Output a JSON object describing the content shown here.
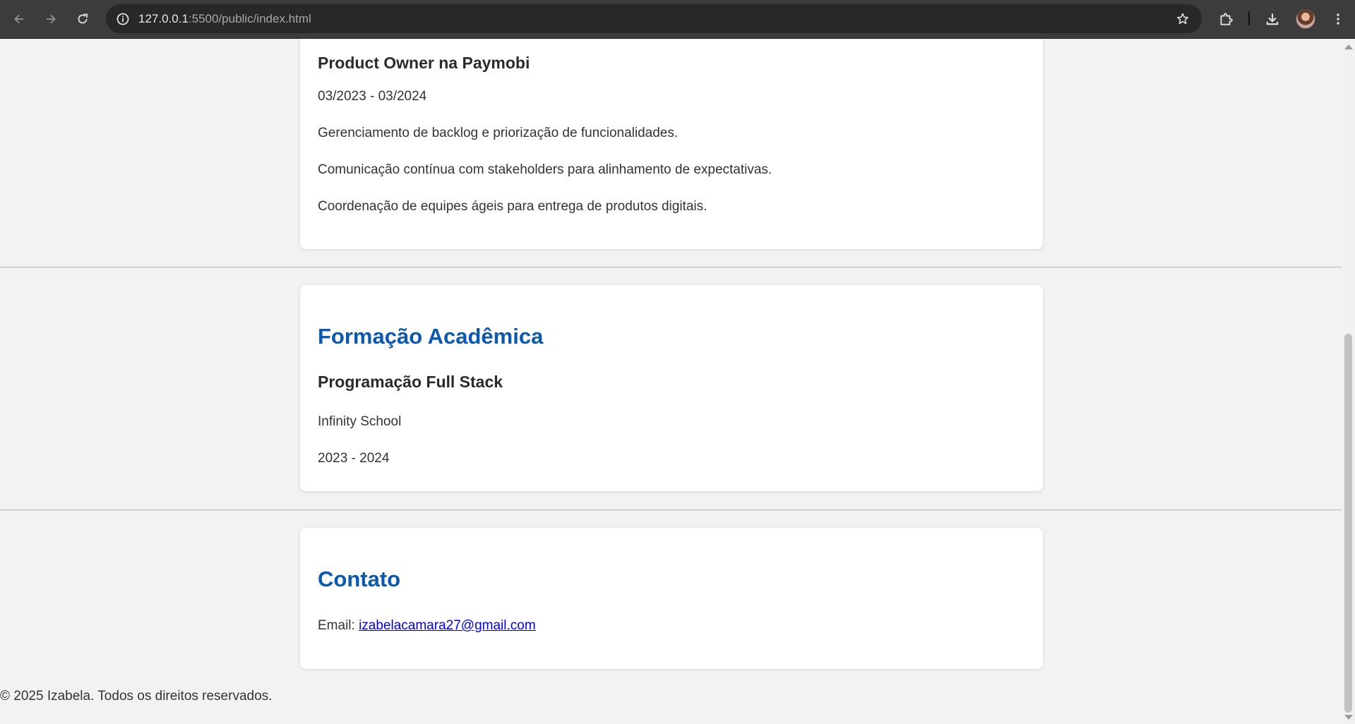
{
  "browser": {
    "url_host": "127.0.0.1",
    "url_rest": ":5500/public/index.html"
  },
  "experience": {
    "job_title": "Product Owner na Paymobi",
    "period": "03/2023 - 03/2024",
    "items": [
      "Gerenciamento de backlog e priorização de funcionalidades.",
      "Comunicação contínua com stakeholders para alinhamento de expectativas.",
      "Coordenação de equipes ágeis para entrega de produtos digitais."
    ]
  },
  "education": {
    "heading": "Formação Acadêmica",
    "course": "Programação Full Stack",
    "school": "Infinity School",
    "period": "2023 - 2024"
  },
  "contact": {
    "heading": "Contato",
    "email_label": "Email: ",
    "email": "izabelacamara27@gmail.com"
  },
  "footer": {
    "text": "© 2025 Izabela. Todos os direitos reservados."
  },
  "colors": {
    "section_heading": "#0b58b0",
    "link": "#0000ee",
    "page_background": "#f2f2f2",
    "chrome": "#3c3c3c"
  },
  "icons": [
    "back-arrow-icon",
    "forward-arrow-icon",
    "reload-icon",
    "site-info-icon",
    "bookmark-star-icon",
    "extensions-icon",
    "download-icon",
    "profile-avatar",
    "more-menu-icon"
  ]
}
